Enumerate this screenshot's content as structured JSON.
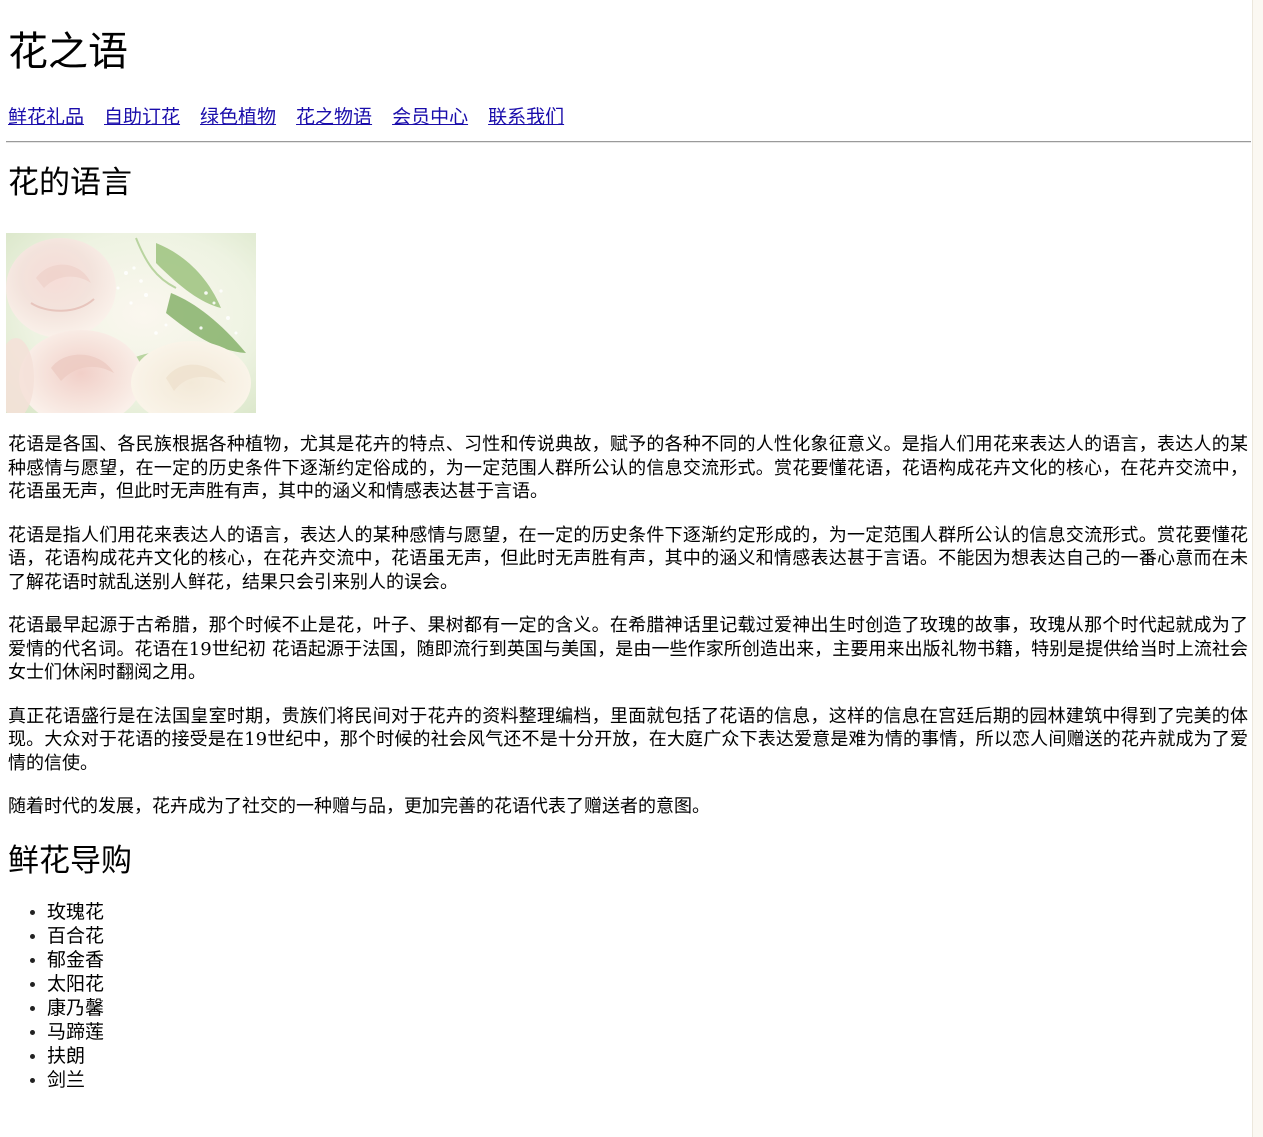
{
  "site_title": "花之语",
  "nav": {
    "items": [
      "鲜花礼品",
      "自助订花",
      "绿色植物",
      "花之物语",
      "会员中心",
      "联系我们"
    ]
  },
  "section_language": {
    "heading": "花的语言",
    "image_icon": "rose-photo",
    "paragraphs": [
      "花语是各国、各民族根据各种植物，尤其是花卉的特点、习性和传说典故，赋予的各种不同的人性化象征意义。是指人们用花来表达人的语言，表达人的某种感情与愿望，在一定的历史条件下逐渐约定俗成的，为一定范围人群所公认的信息交流形式。赏花要懂花语，花语构成花卉文化的核心，在花卉交流中，花语虽无声，但此时无声胜有声，其中的涵义和情感表达甚于言语。",
      "花语是指人们用花来表达人的语言，表达人的某种感情与愿望，在一定的历史条件下逐渐约定形成的，为一定范围人群所公认的信息交流形式。赏花要懂花语，花语构成花卉文化的核心，在花卉交流中，花语虽无声，但此时无声胜有声，其中的涵义和情感表达甚于言语。不能因为想表达自己的一番心意而在未了解花语时就乱送别人鲜花，结果只会引来别人的误会。",
      "花语最早起源于古希腊，那个时候不止是花，叶子、果树都有一定的含义。在希腊神话里记载过爱神出生时创造了玫瑰的故事，玫瑰从那个时代起就成为了爱情的代名词。花语在19世纪初 花语起源于法国，随即流行到英国与美国，是由一些作家所创造出来，主要用来出版礼物书籍，特别是提供给当时上流社会女士们休闲时翻阅之用。",
      "真正花语盛行是在法国皇室时期，贵族们将民间对于花卉的资料整理编档，里面就包括了花语的信息，这样的信息在宫廷后期的园林建筑中得到了完美的体现。大众对于花语的接受是在19世纪中，那个时候的社会风气还不是十分开放，在大庭广众下表达爱意是难为情的事情，所以恋人间赠送的花卉就成为了爱情的信使。",
      "随着时代的发展，花卉成为了社交的一种赠与品，更加完善的花语代表了赠送者的意图。"
    ]
  },
  "section_guide": {
    "heading": "鲜花导购",
    "items": [
      "玫瑰花",
      "百合花",
      "郁金香",
      "太阳花",
      "康乃馨",
      "马蹄莲",
      "扶朗",
      "剑兰"
    ]
  },
  "colors": {
    "link": "#1a0dab",
    "rule": "#9a9a9a",
    "right_edge": "#fbf8f2"
  }
}
